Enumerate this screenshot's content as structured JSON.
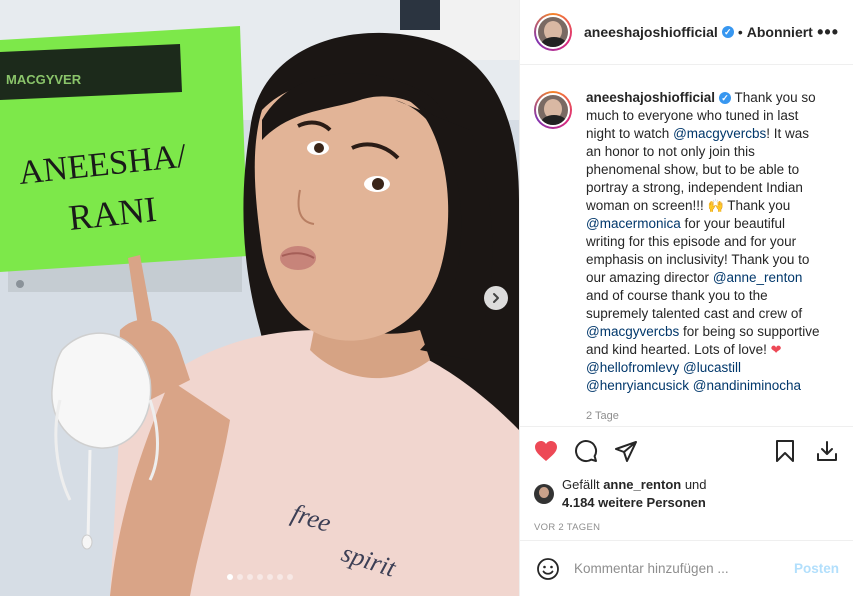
{
  "profile": {
    "username": "aneeshajoshiofficial",
    "follow_state": "Abonniert",
    "separator": "•",
    "verified_mark": "✓"
  },
  "photo": {
    "sign_brand": "MACGYVER",
    "sign_line1": "ANEESHA/",
    "sign_line2": "RANI",
    "shirt_text1": "free",
    "shirt_text2": "spirit",
    "slide_count": 7,
    "active_slide": 0
  },
  "caption": {
    "username": "aneeshajoshiofficial",
    "p1": " Thank you so much to everyone who tuned in last night to watch ",
    "m1": "@macgyvercbs",
    "p2": "! It was an honor to not only join this phenomenal show, but to be able to portray a strong, independent Indian woman on screen!!! ",
    "emoji1": "🙌",
    "p3": " Thank you ",
    "m2": "@macermonica",
    "p4": " for your beautiful writing for this episode and for your emphasis on inclusivity! Thank you to our amazing director ",
    "m3": "@anne_renton",
    "p5": " and of course thank you to the supremely talented cast and crew of ",
    "m4": "@macgyvercbs",
    "p6": " for being so supportive and kind hearted. Lots of love! ",
    "emoji2": "❤",
    "m5": "@hellofromlevy",
    "m6": "@lucastill",
    "m7": "@henryiancusick",
    "m8": "@nandiniminocha",
    "time_ago": "2 Tage"
  },
  "likes": {
    "prefix": "Gefällt ",
    "liker": "anne_renton",
    "suffix": " und",
    "count": "4.184 weitere Personen"
  },
  "date_label": "VOR 2 TAGEN",
  "comment": {
    "placeholder": "Kommentar hinzufügen ...",
    "post_label": "Posten"
  },
  "colors": {
    "link": "#00376b",
    "like_red": "#ed4956",
    "verified": "#3897f0",
    "post_disabled": "#b2dffc"
  }
}
